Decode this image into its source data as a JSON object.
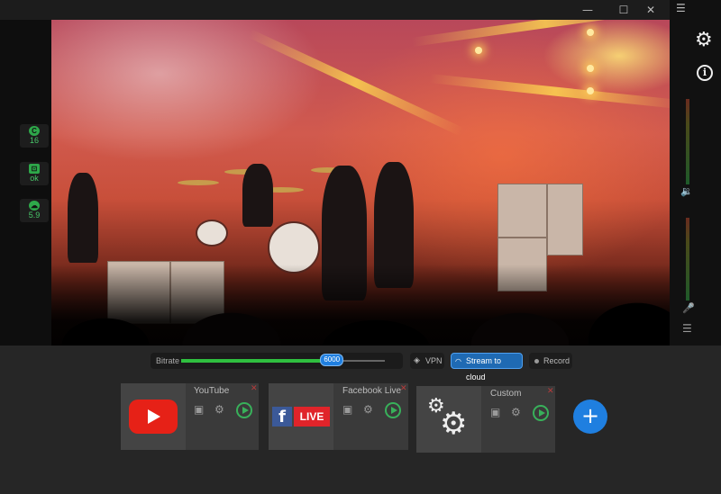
{
  "window": {
    "minimize_icon": "—",
    "maximize_icon": "☐",
    "close_icon": "✕",
    "menu_icon": "☰"
  },
  "status": [
    {
      "icon": "C",
      "value": "16",
      "semantic": "cpu"
    },
    {
      "icon": "⊡",
      "value": "ok",
      "semantic": "connection"
    },
    {
      "icon": "☁",
      "value": "5.9",
      "semantic": "upload"
    }
  ],
  "right": {
    "settings_icon": "⚙",
    "info_icon": "i",
    "volume_icon": "🔉",
    "mic_icon": "🎤",
    "list_icon": "☰"
  },
  "bitrate": {
    "label": "Bitrate",
    "value": "6000",
    "fraction": 0.74
  },
  "toggles": {
    "vpn": "VPN",
    "stream": "Stream to cloud",
    "record": "Record"
  },
  "destinations": [
    {
      "name": "YouTube"
    },
    {
      "name": "Facebook Live",
      "badge": "LIVE"
    },
    {
      "name": "Custom"
    }
  ],
  "add_label": "+",
  "colors": {
    "accent": "#1f7fe0",
    "ok_green": "#38b05a",
    "close_red": "#b83b3b"
  }
}
